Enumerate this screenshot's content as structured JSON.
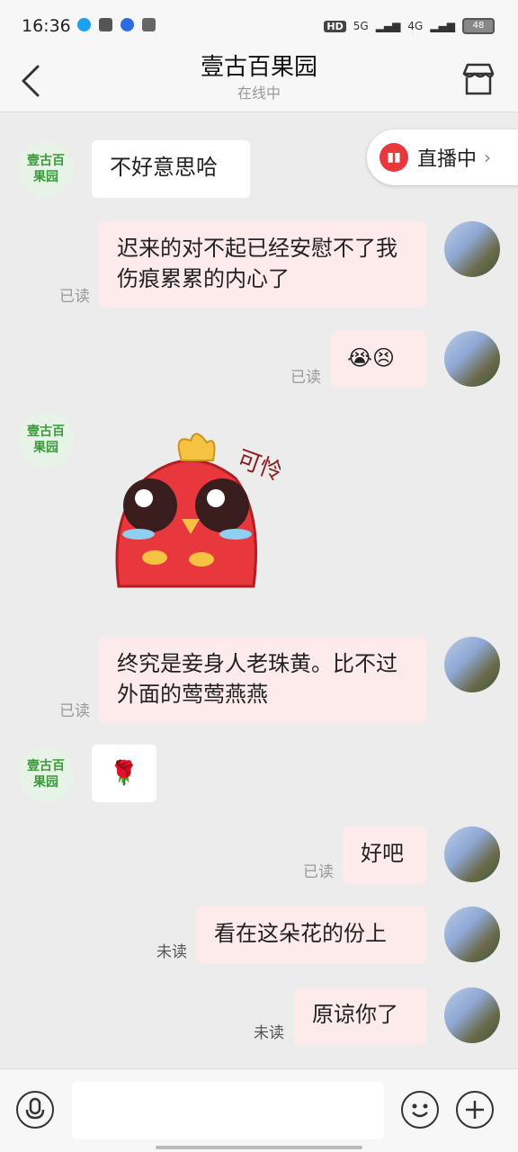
{
  "status_bar": {
    "time": "16:36",
    "network": "5G",
    "network2": "4G",
    "battery": "48"
  },
  "header": {
    "title": "壹古百果园",
    "subtitle": "在线中"
  },
  "live": {
    "label": "直播中"
  },
  "shop_avatar_text": "壹古百果园",
  "messages": [
    {
      "from": "shop",
      "text": "不好意思哈"
    },
    {
      "from": "me",
      "text": "迟来的对不起已经安慰不了我伤痕累累的内心了",
      "status": "已读"
    },
    {
      "from": "me",
      "text": "😭😣",
      "status": "已读"
    },
    {
      "from": "shop",
      "text": "[sticker]",
      "sticker_text": "可怜"
    },
    {
      "from": "me",
      "text": "终究是妾身人老珠黄。比不过外面的莺莺燕燕",
      "status": "已读"
    },
    {
      "from": "shop",
      "text": "🌹"
    },
    {
      "from": "me",
      "text": "好吧",
      "status": "已读"
    },
    {
      "from": "me",
      "text": "看在这朵花的份上",
      "status": "未读"
    },
    {
      "from": "me",
      "text": "原谅你了",
      "status": "未读"
    }
  ],
  "colors": {
    "accent": "#e8383d",
    "out_bubble": "#fdeaea",
    "shop_green": "#3a9b3a"
  }
}
